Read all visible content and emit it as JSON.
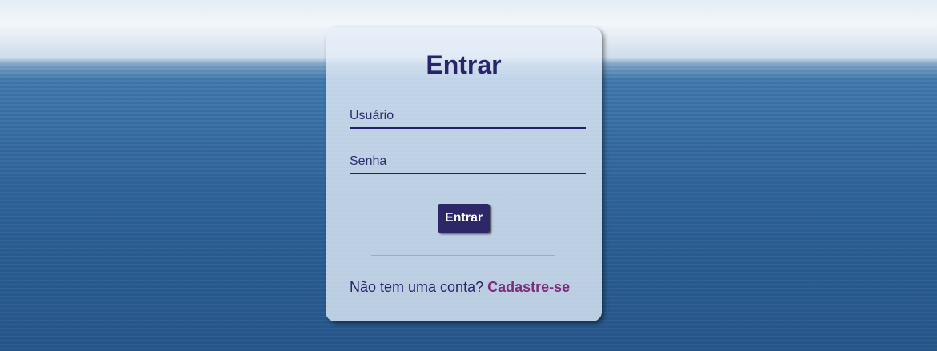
{
  "login": {
    "title": "Entrar",
    "username_placeholder": "Usuário",
    "username_value": "",
    "password_placeholder": "Senha",
    "password_value": "",
    "submit_label": "Entrar",
    "signup_prompt": "Não tem uma conta?",
    "signup_link": "Cadastre-se"
  },
  "colors": {
    "primary": "#2c2766",
    "link": "#7b2c7a",
    "text": "#27246a"
  }
}
